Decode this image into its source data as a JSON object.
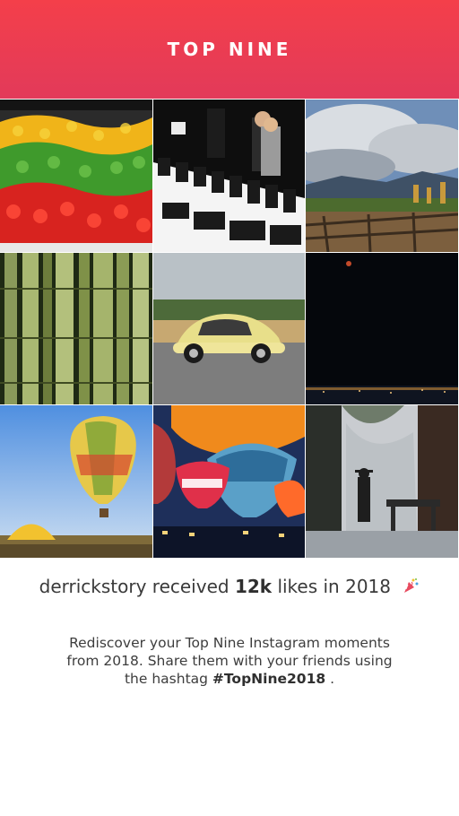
{
  "header": {
    "title": "TOP NINE"
  },
  "grid": {
    "tiles": [
      "tile-peppers",
      "tile-camera-lenses",
      "tile-landscape-clouds",
      "tile-bamboo",
      "tile-yellow-beetle",
      "tile-night-sky",
      "tile-hot-air-balloon",
      "tile-balloons-night",
      "tile-forest-silhouette"
    ]
  },
  "summary": {
    "username": "derrickstory",
    "received": "received",
    "likes_count": "12k",
    "likes_in": "likes in 2018"
  },
  "description": {
    "text": "Rediscover your Top Nine Instagram moments from 2018. Share them with your friends using the hashtag ",
    "hashtag": "#TopNine2018",
    "end": " ."
  },
  "icons": {
    "party": "confetti-popper-icon"
  },
  "colors": {
    "header_top": "#f43f4a",
    "header_bottom": "#e23a5a",
    "text": "#3a3a3a"
  }
}
